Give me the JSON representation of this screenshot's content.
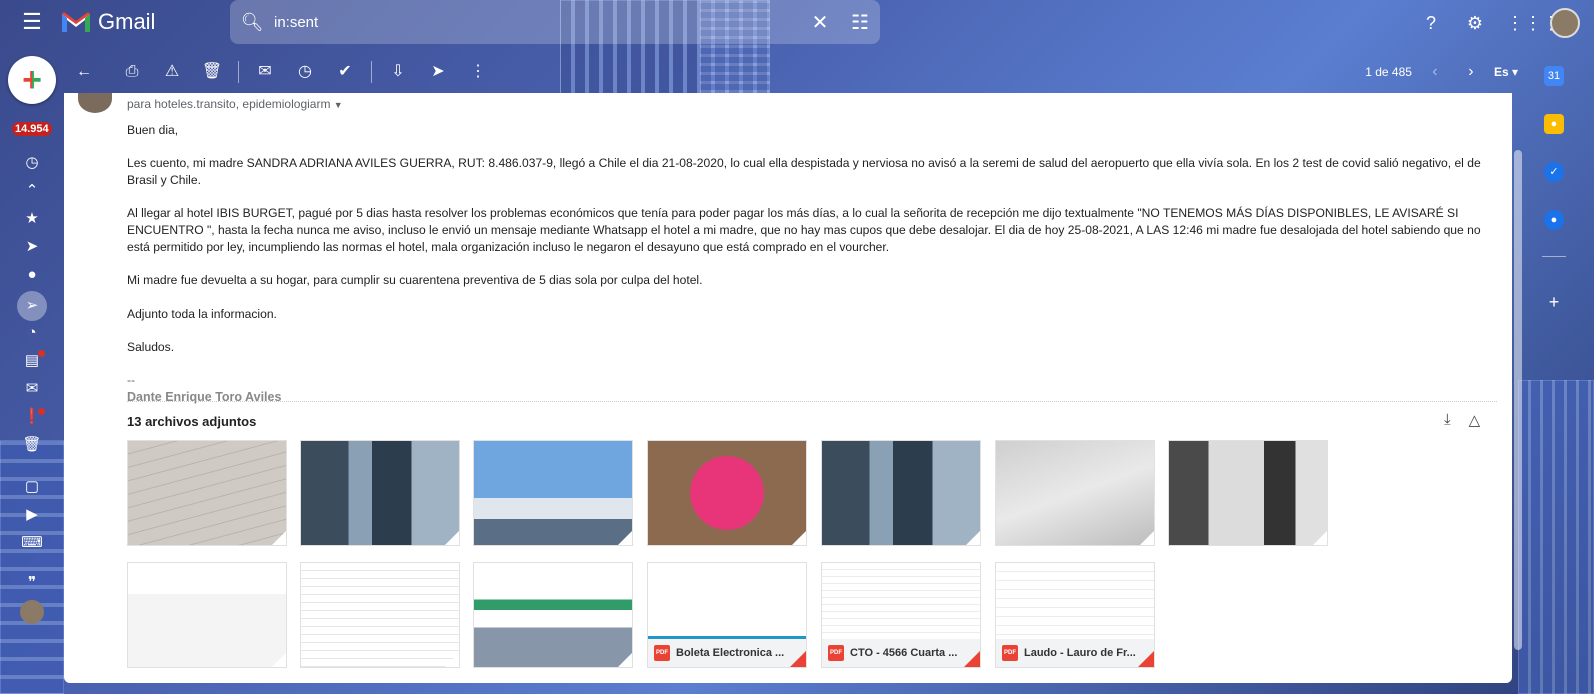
{
  "app": {
    "name": "Gmail"
  },
  "search": {
    "value": "in:sent"
  },
  "rail": {
    "unread_badge": "14.954"
  },
  "toolbar": {
    "pagination": "1 de 485",
    "language": "Es"
  },
  "email": {
    "recipients": "para hoteles.transito, epidemiologiarm",
    "greeting": "Buen dia,",
    "paragraphs": [
      "Les cuento, mi madre SANDRA ADRIANA AVILES GUERRA, RUT: 8.486.037-9, llegó a Chile el dia 21-08-2020, lo cual ella despistada y nerviosa no avisó a la seremi de salud del aeropuerto que ella vivía sola. En los 2 test de covid salió negativo, el de Brasil y Chile.",
      "Al llegar al hotel IBIS BURGET, pagué por 5 dias hasta resolver los problemas económicos que tenía para poder pagar los más días, a lo cual la señorita de recepción me dijo textualmente \"NO TENEMOS MÁS DÍAS DISPONIBLES, LE AVISARÉ SI ENCUENTRO \", hasta la fecha nunca me aviso, incluso le envió un mensaje mediante Whatsapp el hotel a mi madre, que no hay mas cupos que debe desalojar. El dia de hoy 25-08-2021, A LAS 12:46 mi madre fue desalojada del hotel sabiendo que no está permitido por ley, incumpliendo las normas el hotel, mala organización incluso le negaron el desayuno que está comprado en el vourcher.",
      "Mi madre fue devuelta a su hogar, para cumplir su cuarentena preventiva de 5 dias sola por culpa del hotel.",
      "Adjunto toda la informacion.",
      "Saludos."
    ],
    "signature_dash": "--",
    "signature_name": "Dante Enrique Toro Aviles",
    "attachments_title": "13 archivos adjuntos",
    "pdf_attachments": [
      {
        "name": "Boleta Electronica ..."
      },
      {
        "name": "CTO - 4566 Cuarta ..."
      },
      {
        "name": "Laudo - Lauro de Fr..."
      }
    ],
    "pdf_label": "PDF"
  },
  "icons": {
    "menu": "menu-icon",
    "search": "search-icon",
    "clear": "close-icon",
    "filters": "tune-icon",
    "help": "help-icon",
    "settings": "gear-icon",
    "apps": "apps-grid-icon"
  },
  "colors": {
    "accent": "#ea4335",
    "badge": "#c5221f"
  }
}
